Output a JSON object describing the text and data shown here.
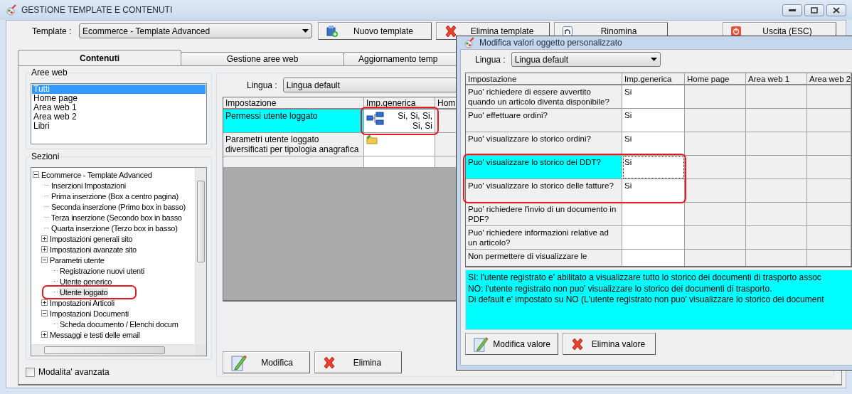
{
  "window": {
    "title": "GESTIONE TEMPLATE E CONTENUTI"
  },
  "template": {
    "label": "Template :",
    "value": "Ecommerce - Template Advanced"
  },
  "toolbar": [
    {
      "label": "Nuovo template",
      "kind": "new"
    },
    {
      "label": "Elimina template",
      "kind": "delete"
    },
    {
      "label": "Rinomina",
      "kind": "rename"
    },
    {
      "label": "Uscita (ESC)",
      "kind": "exit"
    }
  ],
  "tabs": [
    {
      "label": "Contenuti",
      "selected": true
    },
    {
      "label": "Gestione aree web",
      "selected": false
    },
    {
      "label": "Aggiornamento temp",
      "selected": false
    }
  ],
  "aree_web": {
    "title": "Aree web",
    "items": [
      {
        "label": "Tutti",
        "selected": true
      },
      {
        "label": "Home page",
        "selected": false
      },
      {
        "label": "Area web 1",
        "selected": false
      },
      {
        "label": "Area web 2",
        "selected": false
      },
      {
        "label": "Libri",
        "selected": false
      }
    ]
  },
  "sezioni": {
    "title": "Sezioni",
    "tree": [
      {
        "label": "Ecommerce - Template Advanced",
        "expanded": true,
        "selected": false,
        "children": [
          {
            "label": "Inserzioni Impostazioni",
            "selected": false
          },
          {
            "label": "Prima inserzione (Box a centro pagina)",
            "selected": false
          },
          {
            "label": "Seconda inserzione (Primo box in basso)",
            "selected": false
          },
          {
            "label": "Terza inserzione (Secondo box in basso",
            "selected": false
          },
          {
            "label": "Quarta inserzione (Terzo box in basso)",
            "selected": false
          },
          {
            "label": "Impostazioni generali sito",
            "expanded": false,
            "selected": false
          },
          {
            "label": "Impostazioni avanzate sito",
            "expanded": false,
            "selected": false
          },
          {
            "label": "Parametri utente",
            "expanded": true,
            "selected": false,
            "children": [
              {
                "label": "Registrazione nuovi utenti",
                "selected": false
              },
              {
                "label": "Utente generico",
                "selected": false
              },
              {
                "label": "Utente loggato",
                "selected": true
              }
            ]
          },
          {
            "label": "Impostazioni Articoli",
            "expanded": false,
            "selected": false
          },
          {
            "label": "Impostazioni Documenti",
            "expanded": true,
            "selected": false,
            "children": [
              {
                "label": "Scheda documento / Elenchi docum",
                "selected": false
              }
            ]
          },
          {
            "label": "Messaggi e testi delle email",
            "expanded": false,
            "selected": false
          }
        ]
      }
    ]
  },
  "advanced_mode": {
    "label": "Modalita' avanzata",
    "checked": false
  },
  "content": {
    "language_label": "Lingua :",
    "language": "Lingua default",
    "columns": [
      "Impostazione",
      "Imp.generica",
      "Hom"
    ],
    "rows": [
      {
        "setting": "Permessi utente loggato",
        "value": "Si, Si, Si, Si, Si",
        "kind": "tree",
        "selected": true
      },
      {
        "setting": "Parametri utente loggato diversificati per tipologia anagrafica",
        "kind": "folder",
        "selected": false
      }
    ],
    "buttons": [
      {
        "label": "Modifica",
        "kind": "edit"
      },
      {
        "label": "Elimina",
        "kind": "delete"
      }
    ]
  },
  "dialog": {
    "title": "Modifica valori oggetto personalizzato",
    "language_label": "Lingua :",
    "language": "Lingua default",
    "columns": [
      "Impostazione",
      "Imp.generica",
      "Home page",
      "Area web 1",
      "Area web 2"
    ],
    "rows": [
      {
        "setting": "Puo' richiedere di essere avvertito quando un articolo diventa disponibile?",
        "value": "Si",
        "selected": false
      },
      {
        "setting": "Puo' effettuare ordini?",
        "value": "Si",
        "selected": false
      },
      {
        "setting": "Puo' visualizzare lo storico ordini?",
        "value": "Si",
        "selected": false
      },
      {
        "setting": "Puo' visualizzare lo storico dei DDT?",
        "value": "Si",
        "selected": true
      },
      {
        "setting": "Puo' visualizzare lo storico delle fatture?",
        "value": "Si",
        "selected": false
      },
      {
        "setting": "Puo' richiedere l'invio di un documento in PDF?",
        "selected": false
      },
      {
        "setting": "Puo' richiedere informazioni relative ad un articolo?",
        "selected": false
      },
      {
        "setting": "Non permettere di visualizzare le",
        "selected": false
      }
    ],
    "description": [
      "SI: l'utente registrato e' abilitato a visualizzare tutto lo storico dei documenti di trasporto assoc",
      "NO: l'utente registrato non puo' visualizzare lo storico dei documenti di trasporto.",
      "Di default e' impostato su NO (L'utente registrato non puo' visualizzare lo storico dei document"
    ],
    "buttons": [
      {
        "label": "Modifica valore",
        "kind": "edit"
      },
      {
        "label": "Elimina valore",
        "kind": "delete"
      }
    ]
  }
}
